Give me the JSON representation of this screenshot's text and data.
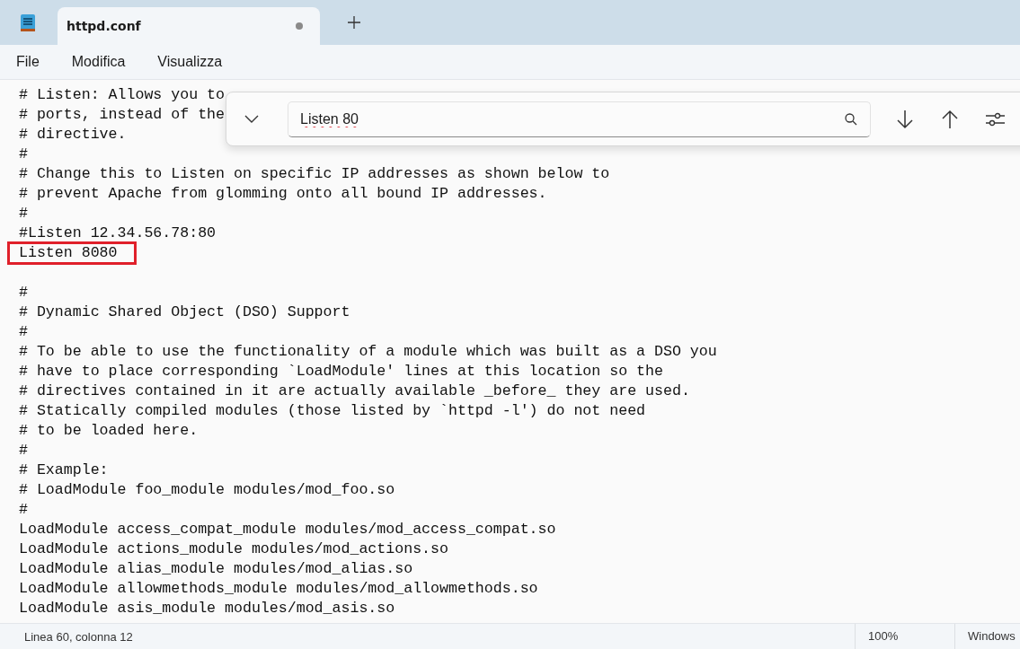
{
  "tabs": [
    {
      "label": "httpd.conf",
      "selected": true,
      "modified": true
    }
  ],
  "menu": [
    "File",
    "Modifica",
    "Visualizza"
  ],
  "find": {
    "value": "Listen 80"
  },
  "editor": {
    "blocks": [
      {
        "lines": [
          {
            "text": "# Listen: Allows you to",
            "highlighted": false
          },
          {
            "text": "# ports, instead of the",
            "highlighted": false
          },
          {
            "text": "# directive.",
            "highlighted": false
          },
          {
            "text": "#",
            "highlighted": false
          },
          {
            "text": "# Change this to Listen on specific IP addresses as shown below to",
            "highlighted": false
          },
          {
            "text": "# prevent Apache from glomming onto all bound IP addresses.",
            "highlighted": false
          },
          {
            "text": "#",
            "highlighted": false
          },
          {
            "text": "#Listen 12.34.56.78:80",
            "highlighted": false
          },
          {
            "text": "Listen 8080",
            "highlighted": true
          }
        ]
      },
      {
        "lines": [
          {
            "text": "#",
            "highlighted": false
          },
          {
            "text": "# Dynamic Shared Object (DSO) Support",
            "highlighted": false
          },
          {
            "text": "#",
            "highlighted": false
          },
          {
            "text": "# To be able to use the functionality of a module which was built as a DSO you",
            "highlighted": false
          },
          {
            "text": "# have to place corresponding `LoadModule' lines at this location so the",
            "highlighted": false
          },
          {
            "text": "# directives contained in it are actually available _before_ they are used.",
            "highlighted": false
          },
          {
            "text": "# Statically compiled modules (those listed by `httpd -l') do not need",
            "highlighted": false
          },
          {
            "text": "# to be loaded here.",
            "highlighted": false
          },
          {
            "text": "#",
            "highlighted": false
          },
          {
            "text": "# Example:",
            "highlighted": false
          },
          {
            "text": "# LoadModule foo_module modules/mod_foo.so",
            "highlighted": false
          },
          {
            "text": "#",
            "highlighted": false
          },
          {
            "text": "LoadModule access_compat_module modules/mod_access_compat.so",
            "highlighted": false
          },
          {
            "text": "LoadModule actions_module modules/mod_actions.so",
            "highlighted": false
          },
          {
            "text": "LoadModule alias_module modules/mod_alias.so",
            "highlighted": false
          },
          {
            "text": "LoadModule allowmethods_module modules/mod_allowmethods.so",
            "highlighted": false
          },
          {
            "text": "LoadModule asis_module modules/mod_asis.so",
            "highlighted": false
          }
        ]
      }
    ]
  },
  "status_bar": {
    "position": "Linea 60, colonna 12",
    "zoom": "100%",
    "line_ending": "Windows"
  }
}
